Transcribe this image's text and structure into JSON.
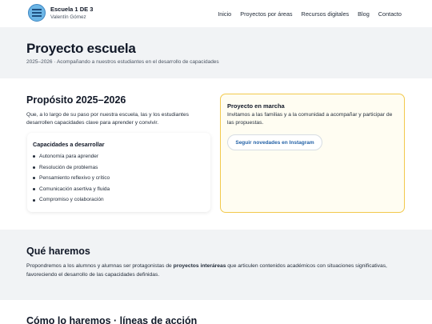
{
  "header": {
    "title": "Escuela 1 DE 3",
    "subtitle": "Valentín Gómez",
    "logo": "school-logo",
    "nav": [
      "Inicio",
      "Proyectos por áreas",
      "Recursos digitales",
      "Blog",
      "Contacto"
    ]
  },
  "hero": {
    "title": "Proyecto escuela",
    "tagline": "2025–2026 · Acompañando a nuestros estudiantes en el desarrollo de capacidades"
  },
  "purpose": {
    "title": "Propósito 2025–2026",
    "text": "Que, a lo largo de su paso por nuestra escuela, las y los estudiantes desarrollen capacidades clave para aprender y convivir.",
    "capabilities": {
      "title": "Capacidades a desarrollar",
      "items": [
        "Autonomía para aprender",
        "Resolución de problemas",
        "Pensamiento reflexivo y crítico",
        "Comunicación asertiva y fluida",
        "Compromiso y colaboración"
      ]
    }
  },
  "project": {
    "title": "Proyecto en marcha",
    "text": "Invitamos a las familias y a la comunidad a acompañar y participar de las propuestas.",
    "button": "Seguir novedades en Instagram"
  },
  "what": {
    "title": "Qué haremos",
    "text_before": "Propondremos a los alumnos y alumnas ser protagonistas de ",
    "text_strong": "proyectos interáreas",
    "text_after": " que articulen contenidos académicos con situaciones significativas, favoreciendo el desarrollo de las capacidades definidas."
  },
  "how": {
    "title": "Cómo lo haremos · líneas de acción"
  },
  "colors": {
    "accent": "#2563a8",
    "highlight_border": "#f2c94c",
    "section_bg": "#f1f3f5"
  }
}
